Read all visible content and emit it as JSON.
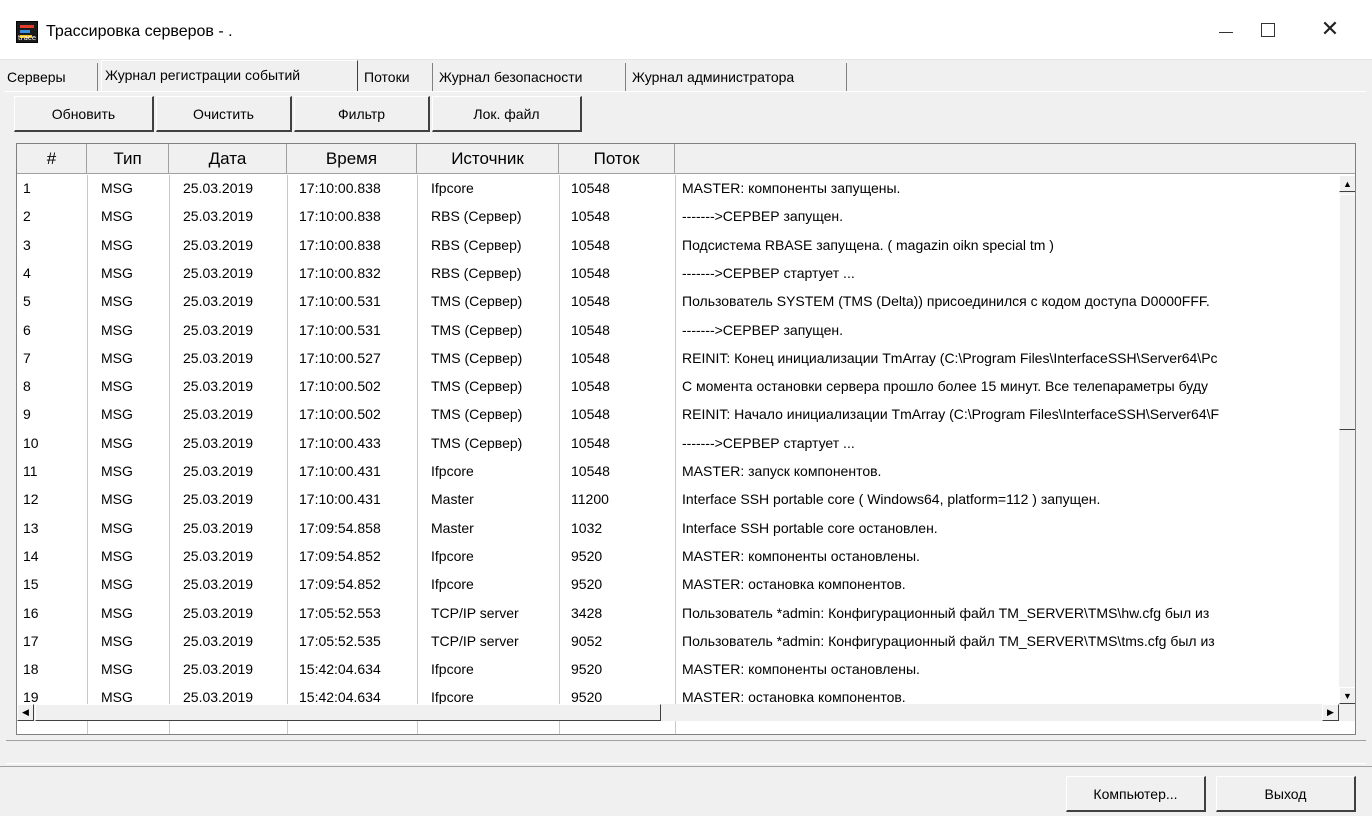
{
  "window": {
    "title": "Трассировка серверов - .",
    "icon": "trace-app-icon",
    "icon_label": "trace"
  },
  "tabs": [
    {
      "label": "Серверы",
      "active": false
    },
    {
      "label": "Журнал регистрации событий",
      "active": true
    },
    {
      "label": "Потоки",
      "active": false
    },
    {
      "label": "Журнал безопасности",
      "active": false
    },
    {
      "label": "Журнал администратора",
      "active": false
    }
  ],
  "toolbar": {
    "refresh_label": "Обновить",
    "clear_label": "Очистить",
    "filter_label": "Фильтр",
    "local_file_label": "Лок. файл"
  },
  "table": {
    "columns": [
      "#",
      "Тип",
      "Дата",
      "Время",
      "Источник",
      "Поток",
      ""
    ],
    "rows": [
      [
        "1",
        "MSG",
        "25.03.2019",
        "17:10:00.838",
        "Ifpcore",
        "10548",
        "MASTER: компоненты запущены."
      ],
      [
        "2",
        "MSG",
        "25.03.2019",
        "17:10:00.838",
        "RBS (Сервер)",
        "10548",
        "------->СЕРВЕР запущен."
      ],
      [
        "3",
        "MSG",
        "25.03.2019",
        "17:10:00.838",
        "RBS (Сервер)",
        "10548",
        "Подсистема RBASE запущена.  ( magazin oikn special tm )"
      ],
      [
        "4",
        "MSG",
        "25.03.2019",
        "17:10:00.832",
        "RBS (Сервер)",
        "10548",
        "------->СЕРВЕР стартует ..."
      ],
      [
        "5",
        "MSG",
        "25.03.2019",
        "17:10:00.531",
        "TMS (Сервер)",
        "10548",
        "Пользователь  SYSTEM (TMS (Delta)) присоединился с кодом доступа D0000FFF."
      ],
      [
        "6",
        "MSG",
        "25.03.2019",
        "17:10:00.531",
        "TMS (Сервер)",
        "10548",
        "------->СЕРВЕР запущен."
      ],
      [
        "7",
        "MSG",
        "25.03.2019",
        "17:10:00.527",
        "TMS (Сервер)",
        "10548",
        "REINIT: Конец инициализации TmArray (C:\\Program Files\\InterfaceSSH\\Server64\\Pc"
      ],
      [
        "8",
        "MSG",
        "25.03.2019",
        "17:10:00.502",
        "TMS (Сервер)",
        "10548",
        "С момента остановки сервера прошло более 15 минут. Все  телепараметры буду"
      ],
      [
        "9",
        "MSG",
        "25.03.2019",
        "17:10:00.502",
        "TMS (Сервер)",
        "10548",
        "REINIT: Начало инициализации TmArray (C:\\Program Files\\InterfaceSSH\\Server64\\F"
      ],
      [
        "10",
        "MSG",
        "25.03.2019",
        "17:10:00.433",
        "TMS (Сервер)",
        "10548",
        "------->СЕРВЕР стартует ..."
      ],
      [
        "11",
        "MSG",
        "25.03.2019",
        "17:10:00.431",
        "Ifpcore",
        "10548",
        "MASTER: запуск компонентов."
      ],
      [
        "12",
        "MSG",
        "25.03.2019",
        "17:10:00.431",
        "Master",
        "11200",
        "Interface SSH portable core ( Windows64, platform=112 ) запущен."
      ],
      [
        "13",
        "MSG",
        "25.03.2019",
        "17:09:54.858",
        "Master",
        "1032",
        "Interface SSH portable core остановлен."
      ],
      [
        "14",
        "MSG",
        "25.03.2019",
        "17:09:54.852",
        "Ifpcore",
        "9520",
        "MASTER: компоненты остановлены."
      ],
      [
        "15",
        "MSG",
        "25.03.2019",
        "17:09:54.852",
        "Ifpcore",
        "9520",
        "MASTER: остановка компонентов."
      ],
      [
        "16",
        "MSG",
        "25.03.2019",
        "17:05:52.553",
        "TCP/IP server",
        "3428",
        "Пользователь *admin: Конфигурационный файл TM_SERVER\\TMS\\hw.cfg был из"
      ],
      [
        "17",
        "MSG",
        "25.03.2019",
        "17:05:52.535",
        "TCP/IP server",
        "9052",
        "Пользователь *admin: Конфигурационный файл TM_SERVER\\TMS\\tms.cfg был из"
      ],
      [
        "18",
        "MSG",
        "25.03.2019",
        "15:42:04.634",
        "Ifpcore",
        "9520",
        "MASTER: компоненты остановлены."
      ],
      [
        "19",
        "MSG",
        "25.03.2019",
        "15:42:04.634",
        "Ifpcore",
        "9520",
        "MASTER: остановка компонентов."
      ]
    ]
  },
  "footer": {
    "computer_label": "Компьютер...",
    "exit_label": "Выход"
  }
}
